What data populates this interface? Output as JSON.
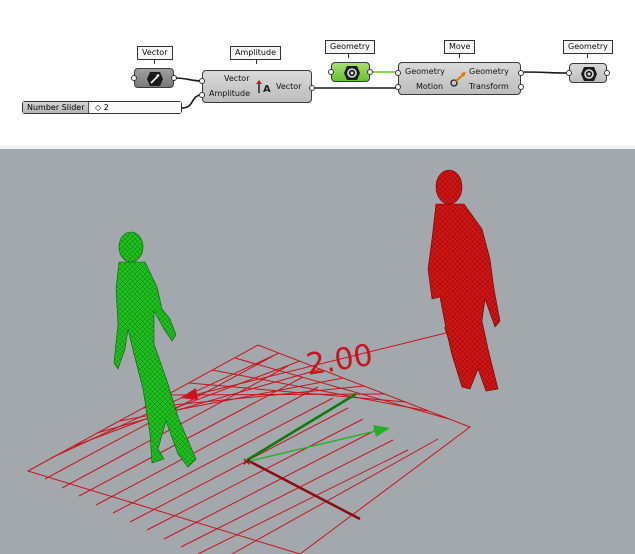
{
  "canvas": {
    "vector_label": "Vector",
    "amplitude_label": "Amplitude",
    "geometry_label_1": "Geometry",
    "move_label": "Move",
    "geometry_label_2": "Geometry",
    "amplitude_node": {
      "input_vector": "Vector",
      "input_amplitude": "Amplitude",
      "output_vector": "Vector",
      "icon_text": "A"
    },
    "move_node": {
      "input_geometry": "Geometry",
      "input_motion": "Motion",
      "output_geometry": "Geometry",
      "output_transform": "Transform"
    },
    "slider": {
      "name": "Number Slider",
      "value": "◇ 2"
    }
  },
  "viewport": {
    "dimension_text": "2.00",
    "colors": {
      "background": "#a3a8ad",
      "original_figure": "#1db81d",
      "moved_figure": "#d41414",
      "grid": "#c8141e"
    }
  }
}
